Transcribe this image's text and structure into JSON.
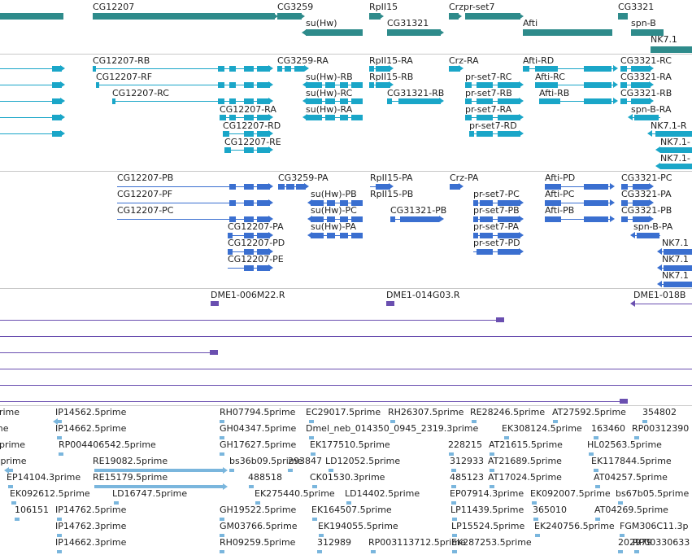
{
  "colors": {
    "gene": "#2e8b8b",
    "mrna": "#1aa6c8",
    "cds": "#3a6fd0",
    "clone": "#6a4fb0",
    "est": "#7ab6dd",
    "separator": "#c8c8c8"
  },
  "tracks": {
    "genes": {
      "labels": [
        {
          "text": "CG12207"
        },
        {
          "text": "CG3259"
        },
        {
          "text": "RpII15"
        },
        {
          "text": "Crzpr-set7"
        },
        {
          "text": "CG3321"
        },
        {
          "text": "su(Hw)"
        },
        {
          "text": "CG31321"
        },
        {
          "text": "Afti"
        },
        {
          "text": "spn-B"
        },
        {
          "text": "NK7.1"
        }
      ]
    },
    "transcripts": {
      "labels": [
        {
          "text": "CG12207-RB"
        },
        {
          "text": "CG3259-RA"
        },
        {
          "text": "RpII15-RA"
        },
        {
          "text": "Crz-RA"
        },
        {
          "text": "Afti-RD"
        },
        {
          "text": "CG3321-RC"
        },
        {
          "text": "CG12207-RF"
        },
        {
          "text": "su(Hw)-RB"
        },
        {
          "text": "RpII15-RB"
        },
        {
          "text": "pr-set7-RC"
        },
        {
          "text": "Afti-RC"
        },
        {
          "text": "CG3321-RA"
        },
        {
          "text": "CG12207-RC"
        },
        {
          "text": "su(Hw)-RC"
        },
        {
          "text": "CG31321-RB"
        },
        {
          "text": "pr-set7-RB"
        },
        {
          "text": "Afti-RB"
        },
        {
          "text": "CG3321-RB"
        },
        {
          "text": "CG12207-RA"
        },
        {
          "text": "su(Hw)-RA"
        },
        {
          "text": "pr-set7-RA"
        },
        {
          "text": "spn-B-RA"
        },
        {
          "text": "CG12207-RD"
        },
        {
          "text": "pr-set7-RD"
        },
        {
          "text": "NK7.1-R"
        },
        {
          "text": "CG12207-RE"
        },
        {
          "text": "NK7.1-"
        },
        {
          "text": "NK7.1-"
        }
      ]
    },
    "proteins": {
      "labels": [
        {
          "text": "CG12207-PB"
        },
        {
          "text": "CG3259-PA"
        },
        {
          "text": "RpII15-PA"
        },
        {
          "text": "Crz-PA"
        },
        {
          "text": "Afti-PD"
        },
        {
          "text": "CG3321-PC"
        },
        {
          "text": "CG12207-PF"
        },
        {
          "text": "su(Hw)-PB"
        },
        {
          "text": "RpII15-PB"
        },
        {
          "text": "pr-set7-PC"
        },
        {
          "text": "Afti-PC"
        },
        {
          "text": "CG3321-PA"
        },
        {
          "text": "CG12207-PC"
        },
        {
          "text": "su(Hw)-PC"
        },
        {
          "text": "CG31321-PB"
        },
        {
          "text": "pr-set7-PB"
        },
        {
          "text": "Afti-PB"
        },
        {
          "text": "CG3321-PB"
        },
        {
          "text": "CG12207-PA"
        },
        {
          "text": "su(Hw)-PA"
        },
        {
          "text": "pr-set7-PA"
        },
        {
          "text": "spn-B-PA"
        },
        {
          "text": "CG12207-PD"
        },
        {
          "text": "pr-set7-PD"
        },
        {
          "text": "NK7.1"
        },
        {
          "text": "CG12207-PE"
        },
        {
          "text": "NK7.1"
        },
        {
          "text": "NK7.1"
        }
      ]
    },
    "clones": {
      "labels": [
        {
          "text": "DME1-006M22.R"
        },
        {
          "text": "DME1-014G03.R"
        },
        {
          "text": "DME1-018B"
        }
      ]
    },
    "ests": {
      "labels": [
        {
          "text": "prime"
        },
        {
          "text": "IP14562.5prime"
        },
        {
          "text": "RH07794.5prime"
        },
        {
          "text": "EC29017.5prime"
        },
        {
          "text": "RH26307.5prime"
        },
        {
          "text": "RE28246.5prime"
        },
        {
          "text": "AT27592.5prime"
        },
        {
          "text": "354802"
        },
        {
          "text": "ime"
        },
        {
          "text": "IP14662.5prime"
        },
        {
          "text": "GH04347.5prime"
        },
        {
          "text": "Dmel_neb_014350_0945_2319.3prime"
        },
        {
          "text": "EK308124.5prime"
        },
        {
          "text": "163460"
        },
        {
          "text": "RP00312390"
        },
        {
          "text": "3prime"
        },
        {
          "text": "RP004406542.5prime"
        },
        {
          "text": "GH17627.5prime"
        },
        {
          "text": "EK177510.5prime"
        },
        {
          "text": "228215"
        },
        {
          "text": "AT21615.5prime"
        },
        {
          "text": "HL02563.5prime"
        },
        {
          "text": ".5prime"
        },
        {
          "text": "RE19082.5prime"
        },
        {
          "text": "bs36b09.5prime"
        },
        {
          "text": "293847"
        },
        {
          "text": "LD12052.5prime"
        },
        {
          "text": "312933"
        },
        {
          "text": "AT21689.5prime"
        },
        {
          "text": "EK117844.5prime"
        },
        {
          "text": "EP14104.3prime"
        },
        {
          "text": "RE15179.5prime"
        },
        {
          "text": "488518"
        },
        {
          "text": "CK01530.3prime"
        },
        {
          "text": "485123"
        },
        {
          "text": "AT17024.5prime"
        },
        {
          "text": "AT04257.5prime"
        },
        {
          "text": "EK092612.5prime"
        },
        {
          "text": "LD16747.5prime"
        },
        {
          "text": "EK275440.5prime"
        },
        {
          "text": "LD14402.5prime"
        },
        {
          "text": "EP07914.3prime"
        },
        {
          "text": "EK092007.5prime"
        },
        {
          "text": "bs67b05.5prime"
        },
        {
          "text": "106151"
        },
        {
          "text": "IP14762.5prime"
        },
        {
          "text": "GH19522.5prime"
        },
        {
          "text": "EK164507.5prime"
        },
        {
          "text": "LP11439.5prime"
        },
        {
          "text": "365010"
        },
        {
          "text": "AT04269.5prime"
        },
        {
          "text": "IP14762.3prime"
        },
        {
          "text": "GM03766.5prime"
        },
        {
          "text": "EK194055.5prime"
        },
        {
          "text": "LP15524.5prime"
        },
        {
          "text": "EK240756.5prime"
        },
        {
          "text": "FGM306C11.3p"
        },
        {
          "text": "IP14662.3prime"
        },
        {
          "text": "RH09259.5prime"
        },
        {
          "text": "312989"
        },
        {
          "text": "RP003113712.5prime"
        },
        {
          "text": "EK287253.5prime"
        },
        {
          "text": "202979"
        },
        {
          "text": "RP00330633"
        }
      ]
    }
  }
}
